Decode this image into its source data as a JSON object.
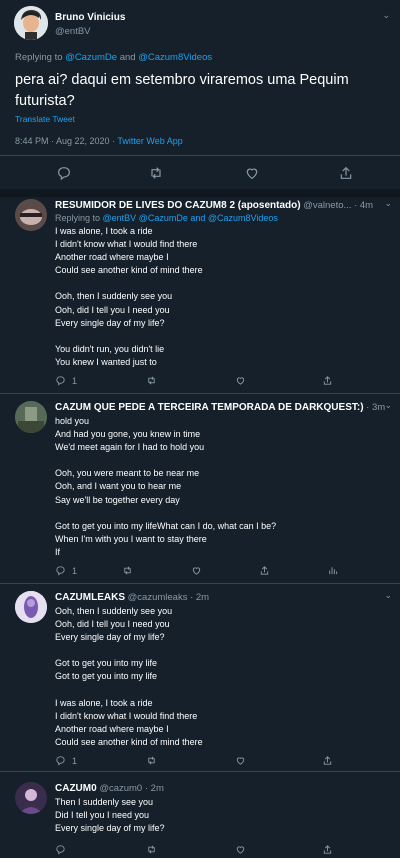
{
  "main_tweet": {
    "author_name": "Bruno Vinicius",
    "handle": "@entBV",
    "replying_prefix": "Replying to ",
    "replying_to_1": "@CazumDe",
    "replying_and": " and ",
    "replying_to_2": "@Cazum8Videos",
    "text_line1": "pera ai? daqui em setembro viraremos uma Pequim",
    "text_line2": "futurista?",
    "translate": "Translate Tweet",
    "timestamp": "8:44 PM · Aug 22, 2020 · ",
    "source": "Twitter Web App"
  },
  "replies": [
    {
      "author_name": "RESUMIDOR DE LIVES DO CAZUM8 2 (aposentado)",
      "handle": "@valneto...",
      "time": "· 4m",
      "replying_prefix": "Replying to ",
      "replying_to": "@entBV @CazumDe and @Cazum8Videos",
      "text": "I was alone, I took a ride\nI didn't know what I would find there\nAnother road where maybe I\nCould see another kind of mind there\n\nOoh, then I suddenly see you\nOoh, did I tell you I need you\nEvery single day of my life?\n\nYou didn't run, you didn't lie\nYou knew I wanted just to",
      "reply_count": "1"
    },
    {
      "author_name": "CAZUM QUE PEDE A TERCEIRA TEMPORADA DE DARKQUEST:)",
      "handle": "",
      "time": "· 3m",
      "text": "hold you\nAnd had you gone, you knew in time\nWe'd meet again for I had to hold you\n\nOoh, you were meant to be near me\nOoh, and I want you to hear me\nSay we'll be together every day\n\nGot to get you into my lifeWhat can I do, what can I be?\nWhen I'm with you I want to stay there\nIf",
      "reply_count": "1"
    },
    {
      "author_name": "CAZUMLEAKS",
      "handle": "@cazumleaks",
      "time": "· 2m",
      "text": "Ooh, then I suddenly see you\nOoh, did I tell you I need you\nEvery single day of my life?\n\nGot to get you into my life\nGot to get you into my life\n\nI was alone, I took a ride\nI didn't know what I would find there\nAnother road where maybe I\nCould see another kind of mind there",
      "reply_count": "1"
    },
    {
      "author_name": "CAZUM0",
      "handle": "@cazum0",
      "time": "· 2m",
      "text": "Then I suddenly see you\nDid I tell you I need you\nEvery single day of my life?",
      "reply_count": ""
    }
  ],
  "colors": {
    "background": "#15202b",
    "accent": "#1da1f2",
    "muted": "#8899a6",
    "divider": "#38444d"
  },
  "icons": [
    "reply-icon",
    "retweet-icon",
    "like-icon",
    "share-icon",
    "analytics-icon",
    "chevron-down-icon"
  ]
}
